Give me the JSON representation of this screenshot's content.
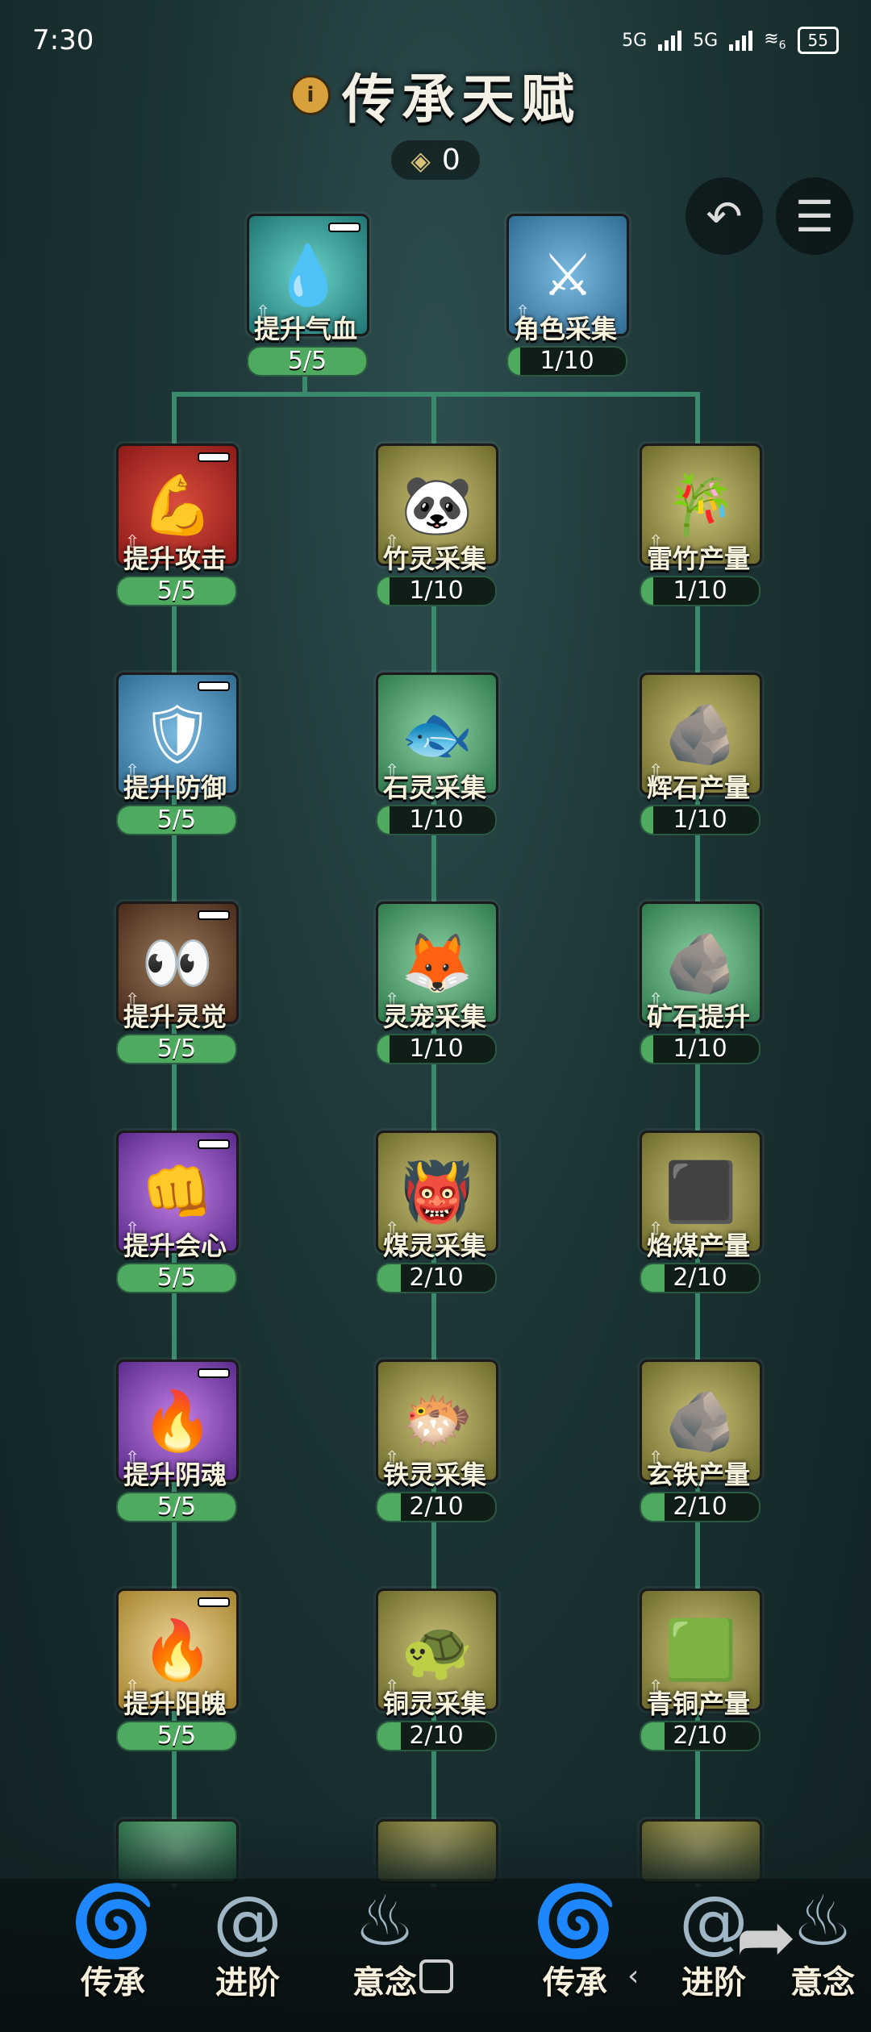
{
  "status": {
    "time": "7:30",
    "network1": "5G",
    "network2": "5G",
    "wifi_badge": "6",
    "battery": "55"
  },
  "header": {
    "title": "传承天赋",
    "currency_value": "0",
    "info_icon": "info-icon",
    "back_icon": "undo-icon",
    "menu_icon": "list-icon"
  },
  "talents": {
    "hp": {
      "name": "提升气血",
      "progress": "5/5",
      "fill": 1.0
    },
    "gather": {
      "name": "角色采集",
      "progress": "1/10",
      "fill": 0.1
    },
    "atk": {
      "name": "提升攻击",
      "progress": "5/5",
      "fill": 1.0
    },
    "bamboo_spirit": {
      "name": "竹灵采集",
      "progress": "1/10",
      "fill": 0.1
    },
    "thunder_bamboo": {
      "name": "雷竹产量",
      "progress": "1/10",
      "fill": 0.1
    },
    "def": {
      "name": "提升防御",
      "progress": "5/5",
      "fill": 1.0
    },
    "stone_spirit": {
      "name": "石灵采集",
      "progress": "1/10",
      "fill": 0.1
    },
    "shine_stone": {
      "name": "辉石产量",
      "progress": "1/10",
      "fill": 0.1
    },
    "sense": {
      "name": "提升灵觉",
      "progress": "5/5",
      "fill": 1.0
    },
    "pet_gather": {
      "name": "灵宠采集",
      "progress": "1/10",
      "fill": 0.1
    },
    "ore_up": {
      "name": "矿石提升",
      "progress": "1/10",
      "fill": 0.1
    },
    "crit": {
      "name": "提升会心",
      "progress": "5/5",
      "fill": 1.0
    },
    "coal_spirit": {
      "name": "煤灵采集",
      "progress": "2/10",
      "fill": 0.2
    },
    "flame_coal": {
      "name": "焰煤产量",
      "progress": "2/10",
      "fill": 0.2
    },
    "yin": {
      "name": "提升阴魂",
      "progress": "5/5",
      "fill": 1.0
    },
    "iron_spirit": {
      "name": "铁灵采集",
      "progress": "2/10",
      "fill": 0.2
    },
    "dark_iron": {
      "name": "玄铁产量",
      "progress": "2/10",
      "fill": 0.2
    },
    "yang": {
      "name": "提升阳魄",
      "progress": "5/5",
      "fill": 1.0
    },
    "copper_spirit": {
      "name": "铜灵采集",
      "progress": "2/10",
      "fill": 0.2
    },
    "bronze": {
      "name": "青铜产量",
      "progress": "2/10",
      "fill": 0.2
    }
  },
  "nav": {
    "items": [
      "传承",
      "进阶",
      "意念",
      "传承",
      "进阶",
      "意念"
    ]
  }
}
